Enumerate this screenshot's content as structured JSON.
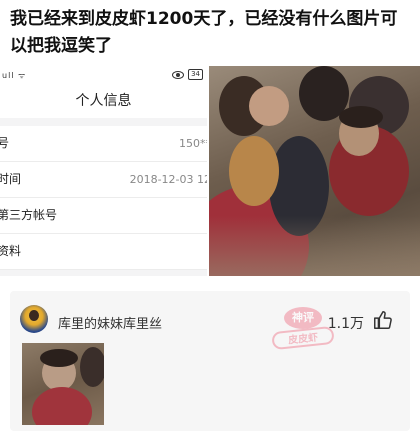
{
  "post": {
    "text": "我已经来到皮皮虾1200天了，已经没有什么图片可以把我逗笑了"
  },
  "screenshot": {
    "status_bar": {
      "signal": "ull ᯤ",
      "battery": "34"
    },
    "title": "个人信息",
    "rows": [
      {
        "label": "号",
        "value": "150**"
      },
      {
        "label": "时间",
        "value": "2018-12-03 12"
      },
      {
        "label": "第三方帐号",
        "value": ""
      },
      {
        "label": "资料",
        "value": ""
      }
    ]
  },
  "comment": {
    "username": "库里的妹妹库里丝",
    "likes": "1.1万",
    "stamp_top": "神评",
    "stamp_bottom": "皮皮虾"
  },
  "icons": [
    "eye-icon",
    "battery-icon",
    "thumbs-up-icon",
    "avatar"
  ],
  "colors": {
    "stamp": "#f08a9a",
    "card_bg": "#f6f6f6"
  }
}
